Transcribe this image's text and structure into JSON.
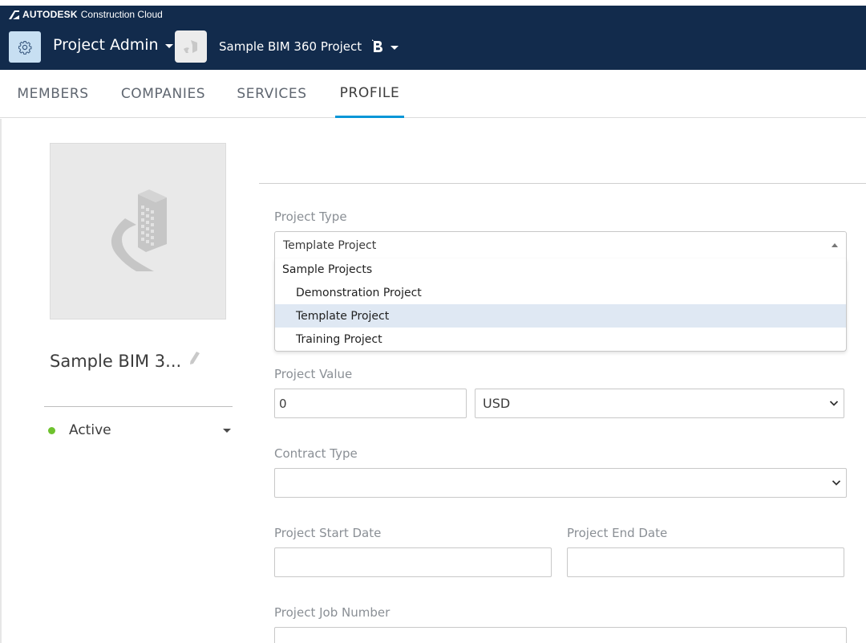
{
  "brand": {
    "strong": "AUTODESK",
    "light": "Construction Cloud"
  },
  "header": {
    "module": "Project Admin",
    "project": "Sample BIM 360 Project"
  },
  "tabs": [
    {
      "label": "MEMBERS"
    },
    {
      "label": "COMPANIES"
    },
    {
      "label": "SERVICES"
    },
    {
      "label": "PROFILE",
      "active": true
    }
  ],
  "profile": {
    "name": "Sample BIM 3...",
    "status": "Active",
    "status_color": "#6ec22e"
  },
  "form": {
    "project_type": {
      "label": "Project Type",
      "value": "Template Project",
      "group": "Sample Projects",
      "options": [
        "Demonstration Project",
        "Template Project",
        "Training Project"
      ],
      "selected_index": 1
    },
    "project_value": {
      "label": "Project Value",
      "value": "0",
      "currency": "USD"
    },
    "contract_type": {
      "label": "Contract Type",
      "value": ""
    },
    "start_date": {
      "label": "Project Start Date",
      "value": ""
    },
    "end_date": {
      "label": "Project End Date",
      "value": ""
    },
    "job_number": {
      "label": "Project Job Number",
      "value": ""
    }
  },
  "colors": {
    "header_bg": "#122b4c",
    "accent": "#0696d7",
    "selected_bg": "#dfe8f3"
  }
}
